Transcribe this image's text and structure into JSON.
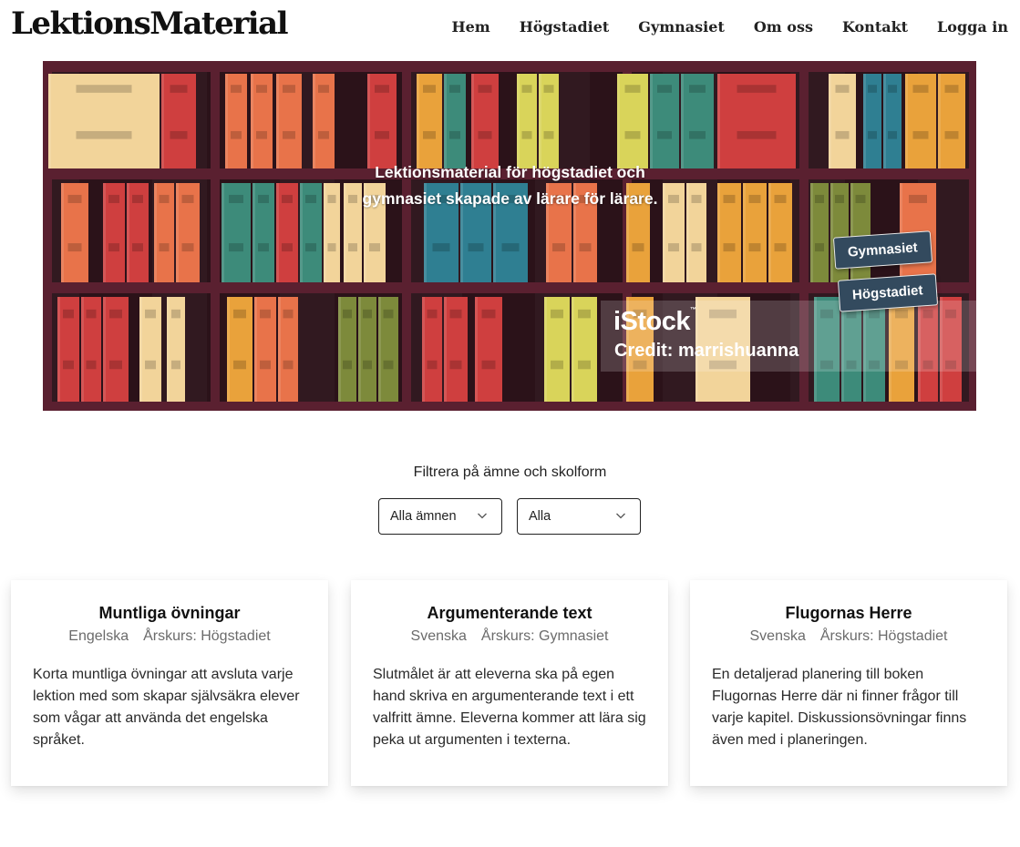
{
  "header": {
    "logo": "LektionsMaterial",
    "nav": [
      "Hem",
      "Högstadiet",
      "Gymnasiet",
      "Om oss",
      "Kontakt",
      "Logga in"
    ]
  },
  "hero": {
    "headline": "Lektionsmaterial för högstadiet och gymnasiet skapade av lärare för lärare.",
    "tags": [
      "Gymnasiet",
      "Högstadiet"
    ],
    "watermark": {
      "brand": "iStock",
      "credit": "Credit: marrishuanna"
    }
  },
  "filter": {
    "title": "Filtrera på ämne och skolform",
    "subject_selected": "Alla ämnen",
    "school_selected": "Alla"
  },
  "cards": [
    {
      "title": "Muntliga övningar",
      "subject": "Engelska",
      "grade": "Årskurs: Högstadiet",
      "description": "Korta muntliga övningar att avsluta varje lektion med som skapar självsäkra elever som vågar att använda det engelska språket."
    },
    {
      "title": "Argumenterande text",
      "subject": "Svenska",
      "grade": "Årskurs: Gymnasiet",
      "description": "Slutmålet är att eleverna ska på egen hand skriva en argumenterande text i ett valfritt ämne. Eleverna kommer att lära sig peka ut argumenten i texterna."
    },
    {
      "title": "Flugornas Herre",
      "subject": "Svenska",
      "grade": "Årskurs: Högstadiet",
      "description": "En detaljerad planering till boken Flugornas Herre där ni finner frågor till varje kapitel. Diskussionsövningar finns även med i planeringen."
    }
  ],
  "colors": {
    "shelf": "#5a2030",
    "shelf_background": "#3a1b25",
    "tag_background": "#334a5e"
  }
}
